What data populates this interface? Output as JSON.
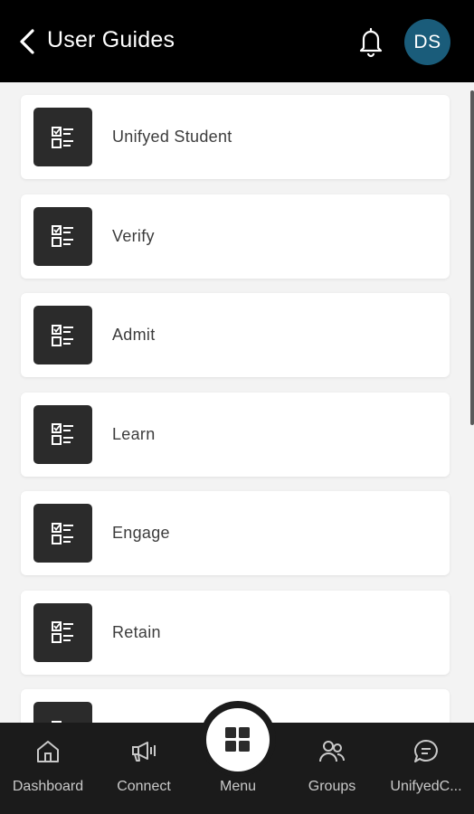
{
  "header": {
    "title": "User Guides",
    "avatar_initials": "DS",
    "avatar_color": "#1a5c7a"
  },
  "guides": [
    {
      "label": "Unifyed Student",
      "icon": "checklist-icon"
    },
    {
      "label": "Verify",
      "icon": "checklist-icon"
    },
    {
      "label": "Admit",
      "icon": "checklist-icon"
    },
    {
      "label": "Learn",
      "icon": "checklist-icon"
    },
    {
      "label": "Engage",
      "icon": "checklist-icon"
    },
    {
      "label": "Retain",
      "icon": "checklist-icon"
    },
    {
      "label": "",
      "icon": "checklist-icon"
    }
  ],
  "bottom_nav": {
    "items": [
      {
        "label": "Dashboard",
        "icon": "home-icon"
      },
      {
        "label": "Connect",
        "icon": "megaphone-icon"
      },
      {
        "label": "Menu",
        "icon": "grid-icon"
      },
      {
        "label": "Groups",
        "icon": "groups-icon"
      },
      {
        "label": "UnifyedC...",
        "icon": "chat-icon"
      }
    ]
  },
  "colors": {
    "header_bg": "#000000",
    "page_bg": "#f3f3f3",
    "tile_bg": "#2b2b2b",
    "nav_bg": "#1b1b1b"
  }
}
